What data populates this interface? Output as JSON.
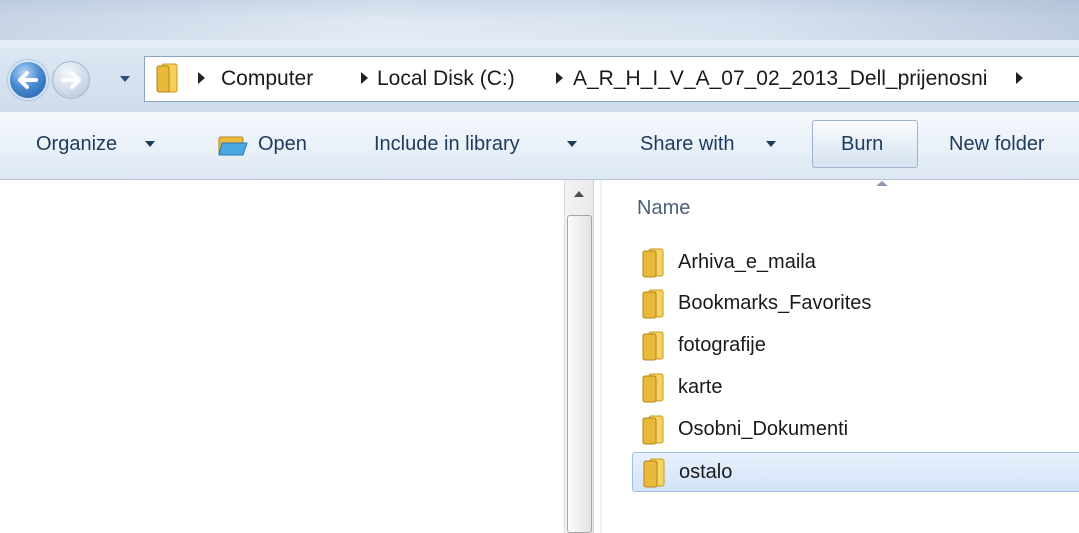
{
  "breadcrumb": [
    "Computer",
    "Local Disk (C:)",
    "A_R_H_I_V_A_07_02_2013_Dell_prijenosni"
  ],
  "toolbar": {
    "organize": "Organize",
    "open": "Open",
    "include_in_library": "Include in library",
    "share_with": "Share with",
    "burn": "Burn",
    "new_folder": "New folder"
  },
  "columns": {
    "name": "Name"
  },
  "files": [
    {
      "name": "Arhiva_e_maila",
      "selected": false
    },
    {
      "name": "Bookmarks_Favorites",
      "selected": false
    },
    {
      "name": "fotografije",
      "selected": false
    },
    {
      "name": "karte",
      "selected": false
    },
    {
      "name": "Osobni_Dokumenti",
      "selected": false
    },
    {
      "name": "ostalo",
      "selected": true
    }
  ],
  "icons": {
    "back": "back-arrow-icon",
    "forward": "forward-arrow-icon",
    "folder": "folder-icon",
    "open": "open-folder-icon"
  },
  "colors": {
    "toolbar_text": "#1e3a5c",
    "selection_bg": "#d3e3f8",
    "selection_border": "#9fc0e8",
    "folder": "#e8b93a"
  }
}
